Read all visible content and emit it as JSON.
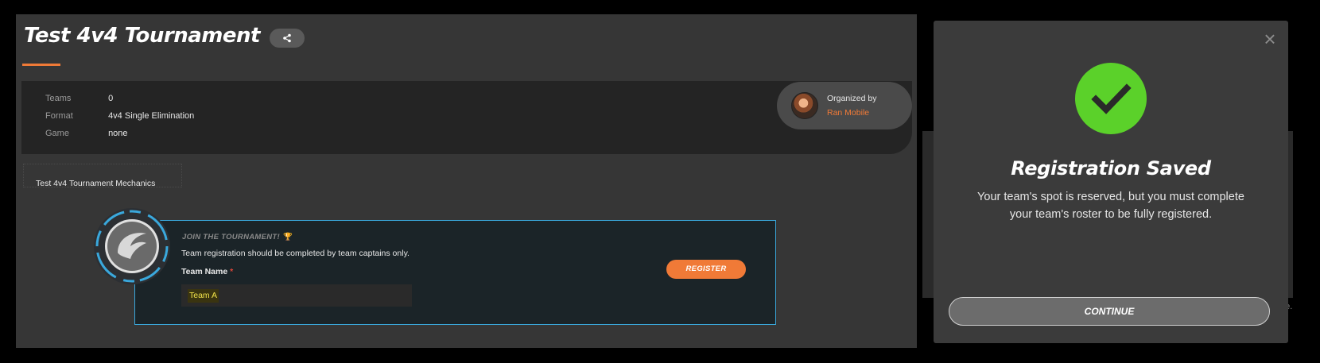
{
  "page": {
    "title": "Test 4v4 Tournament",
    "share_icon": "share-icon",
    "details": [
      {
        "key": "Teams",
        "value": "0"
      },
      {
        "key": "Format",
        "value": "4v4 Single Elimination"
      },
      {
        "key": "Game",
        "value": "none"
      }
    ],
    "organizer": {
      "label": "Organized by",
      "name": "Ran Mobile",
      "avatar_icon": "organizer-avatar"
    },
    "mechanics_label": "Test 4v4 Tournament Mechanics"
  },
  "join": {
    "heading": "JOIN THE TOURNAMENT!",
    "trophy_icon": "trophy-icon",
    "description": "Team registration should be completed by team captains only.",
    "team_name_label": "Team Name",
    "required_mark": "*",
    "team_name_value": "Team A",
    "register_label": "REGISTER"
  },
  "modal": {
    "close_icon": "close-icon",
    "success_icon": "checkmark-icon",
    "title": "Registration Saved",
    "body": "Your team's spot is reserved, but you must complete your team's roster to be fully registered.",
    "continue_label": "CONTINUE",
    "behind_text": "de."
  },
  "colors": {
    "accent": "#f07a37",
    "success": "#5bd12a",
    "join_border": "#3aa8dc",
    "highlight_text": "#f2e34a"
  }
}
